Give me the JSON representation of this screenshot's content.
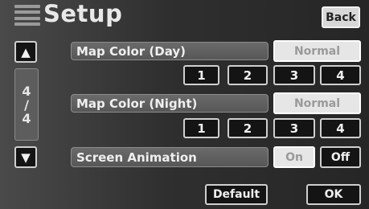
{
  "header": {
    "title": "Setup",
    "back_label": "Back"
  },
  "pager": {
    "current": "4",
    "separator": "/",
    "total": "4"
  },
  "settings": [
    {
      "label": "Map Color (Day)",
      "selected": "Normal",
      "options": [
        "1",
        "2",
        "3",
        "4"
      ]
    },
    {
      "label": "Map Color (Night)",
      "selected": "Normal",
      "options": [
        "1",
        "2",
        "3",
        "4"
      ]
    },
    {
      "label": "Screen Animation",
      "on_label": "On",
      "off_label": "Off"
    }
  ],
  "footer": {
    "default_label": "Default",
    "ok_label": "OK"
  },
  "icons": {
    "menu": "menu-list-icon",
    "up": "arrow-up-icon",
    "down": "arrow-down-icon"
  }
}
